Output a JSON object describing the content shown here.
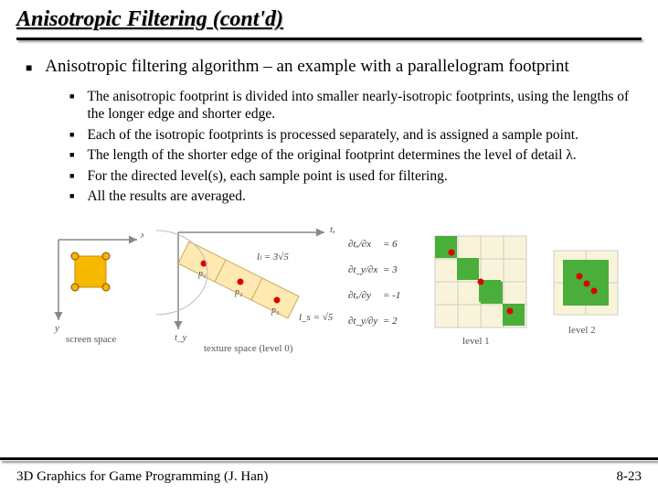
{
  "title": "Anisotropic Filtering (cont'd)",
  "main_bullet": "Anisotropic filtering algorithm – an example with a parallelogram footprint",
  "sub_bullets": [
    "The anisotropic footprint is divided into smaller nearly-isotropic footprints, using the lengths of the longer edge and shorter edge.",
    "Each of the isotropic footprints is processed separately, and is assigned a sample point.",
    "The length of the shorter edge of the original footprint determines the level of detail λ.",
    "For the directed level(s), each sample point is used for filtering.",
    "All the results are averaged."
  ],
  "fig": {
    "screen_space": {
      "x_axis": "x",
      "y_axis": "y",
      "caption": "screen space"
    },
    "texture_space": {
      "tx": "tₓ",
      "ty": "t_y",
      "caption": "texture space (level 0)",
      "p1": "p₁",
      "p2": "p₂",
      "p3": "p₃",
      "ll": "lₗ = 3√5",
      "ls": "l_s = √5",
      "dtx_dx": {
        "lhs": "∂tₓ/∂x",
        "rhs": "= 6"
      },
      "dtx_dy": {
        "lhs": "∂tₓ/∂y",
        "rhs": "= -1"
      },
      "dty_dx": {
        "lhs": "∂t_y/∂x",
        "rhs": "= 3"
      },
      "dty_dy": {
        "lhs": "∂t_y/∂y",
        "rhs": "= 2"
      }
    },
    "levels": {
      "l1": "level 1",
      "l2": "level 2"
    }
  },
  "footer": {
    "left": "3D Graphics for Game Programming (J. Han)",
    "right": "8-23"
  }
}
